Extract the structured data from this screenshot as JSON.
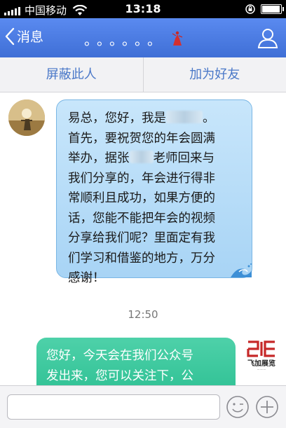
{
  "status_bar": {
    "carrier": "中国移动",
    "time": "13:18",
    "battery_level": 0.95
  },
  "nav": {
    "back_label": "消息",
    "title_dots": "。。。。。。",
    "icons": {
      "back": "chevron-left-icon",
      "profile": "profile-icon",
      "decoration": "dancer-icon"
    }
  },
  "actions": {
    "block": "屏蔽此人",
    "add_friend": "加为好友"
  },
  "messages": {
    "incoming": {
      "lines": [
        [
          "易总，您好，我是",
          "。"
        ],
        [
          "首先，要祝贺您的年会圆满"
        ],
        [
          "举办，据张",
          "老师回来与"
        ],
        [
          "我们分享的，年会进行得非"
        ],
        [
          "常顺利且成功，如果方便的"
        ],
        [
          "话，您能不能把年会的视频"
        ],
        [
          "分享给我们呢？里面定有我"
        ],
        [
          "们学习和借鉴的地方，万分"
        ],
        [
          "感谢！"
        ]
      ]
    },
    "timestamp": "12:50",
    "outgoing": {
      "lines": [
        "您好，今天会在我们公众号",
        "发出来，您可以关注下，公"
      ],
      "logo_text": "飞加展览"
    }
  },
  "input_bar": {
    "placeholder": "",
    "icons": {
      "emoji": "emoji-icon",
      "plus": "plus-icon"
    }
  },
  "colors": {
    "nav": "#4a7dde",
    "incoming_bubble": "#b7dcf7",
    "outgoing_bubble": "#35c79a",
    "action_text": "#4a78c8"
  }
}
